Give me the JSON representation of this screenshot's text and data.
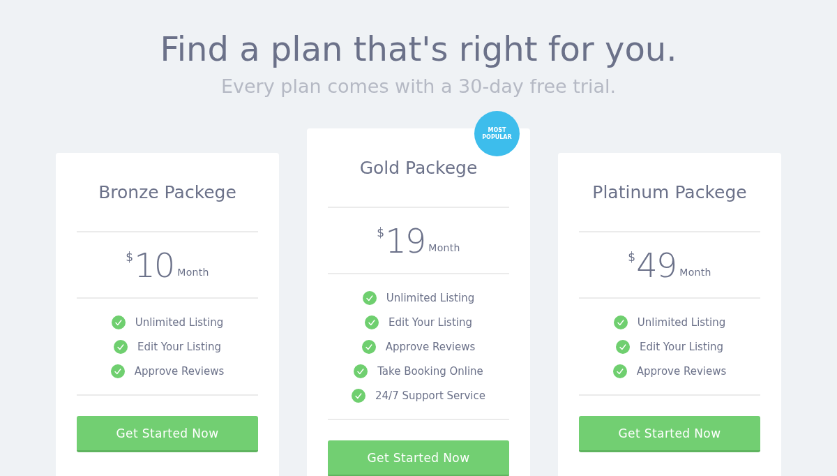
{
  "heading": "Find a plan that's right for you.",
  "subheading": "Every plan comes with a 30-day free trial.",
  "plans": [
    {
      "name": "Bronze Packege",
      "featured": false,
      "currency": "$",
      "price": "10",
      "period": "Month",
      "features": [
        "Unlimited Listing",
        "Edit Your Listing",
        "Approve Reviews"
      ],
      "button": "Get Started Now"
    },
    {
      "name": "Gold Packege",
      "featured": true,
      "badge": "MOST POPULAR",
      "currency": "$",
      "price": "19",
      "period": "Month",
      "features": [
        "Unlimited Listing",
        "Edit Your Listing",
        "Approve Reviews",
        "Take Booking Online",
        "24/7 Support Service"
      ],
      "button": "Get Started Now"
    },
    {
      "name": "Platinum Packege",
      "featured": false,
      "currency": "$",
      "price": "49",
      "period": "Month",
      "features": [
        "Unlimited Listing",
        "Edit Your Listing",
        "Approve Reviews"
      ],
      "button": "Get Started Now"
    }
  ]
}
